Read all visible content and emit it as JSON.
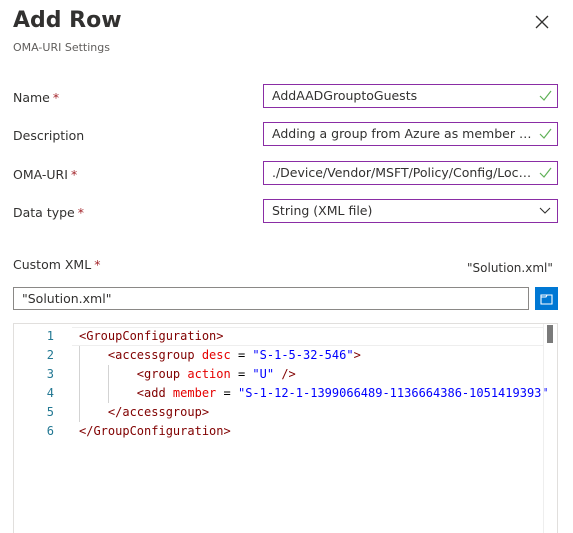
{
  "header": {
    "title": "Add Row",
    "subtitle": "OMA-URI Settings"
  },
  "fields": [
    {
      "label": "Name",
      "required": true,
      "value": "AddAADGrouptoGuests",
      "valid": true
    },
    {
      "label": "Description",
      "required": false,
      "value": "Adding a group from Azure as member of the Guests group",
      "valid": true
    },
    {
      "label": "OMA-URI",
      "required": true,
      "value": "./Device/Vendor/MSFT/Policy/Config/LocalUsersAndGroups/Configure",
      "valid": true
    },
    {
      "label": "Data type",
      "required": true,
      "value": "String (XML file)"
    }
  ],
  "custom_xml": {
    "label": "Custom XML",
    "required": true,
    "file_name_display": "\"Solution.xml\"",
    "file_input_value": "\"Solution.xml\"",
    "browse_icon": "folder-icon"
  },
  "editor": {
    "lines": [
      {
        "n": "1",
        "tokens": [
          [
            "t",
            "<GroupConfiguration>"
          ]
        ]
      },
      {
        "n": "2",
        "tokens": [
          [
            "p",
            "    "
          ],
          [
            "t",
            "<accessgroup "
          ],
          [
            "a",
            "desc"
          ],
          [
            "p",
            " = "
          ],
          [
            "s",
            "\"S-1-5-32-546\""
          ],
          [
            "t",
            ">"
          ]
        ]
      },
      {
        "n": "3",
        "tokens": [
          [
            "p",
            "        "
          ],
          [
            "t",
            "<group "
          ],
          [
            "a",
            "action"
          ],
          [
            "p",
            " = "
          ],
          [
            "s",
            "\"U\""
          ],
          [
            "t",
            " />"
          ]
        ]
      },
      {
        "n": "4",
        "tokens": [
          [
            "p",
            "        "
          ],
          [
            "t",
            "<add "
          ],
          [
            "a",
            "member"
          ],
          [
            "p",
            " = "
          ],
          [
            "s",
            "\"S-1-12-1-1399066489-1136664386-1051419393\""
          ]
        ]
      },
      {
        "n": "5",
        "tokens": [
          [
            "p",
            "    "
          ],
          [
            "t",
            "</accessgroup>"
          ]
        ]
      },
      {
        "n": "6",
        "tokens": [
          [
            "t",
            "</GroupConfiguration>"
          ]
        ]
      }
    ]
  },
  "colors": {
    "accent": "#0078d4",
    "field_border": "#8a2da5",
    "valid": "#5fb157",
    "required": "#a4262c"
  }
}
